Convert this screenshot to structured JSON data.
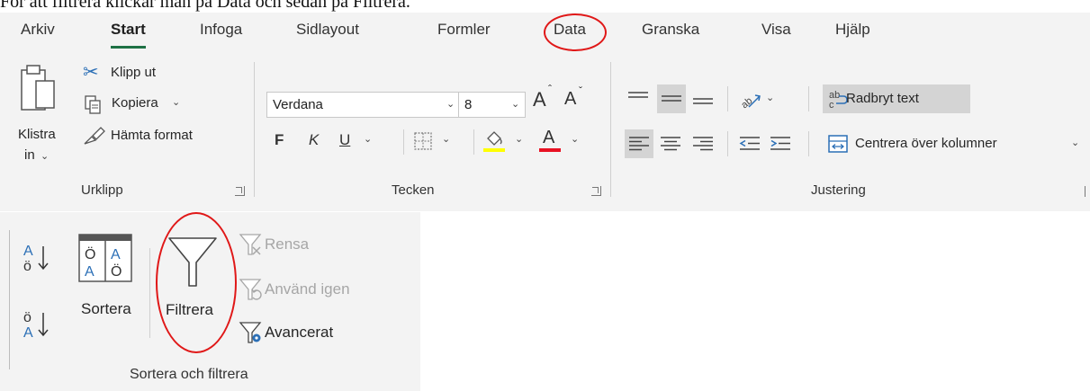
{
  "caption": "För att filtrera klickar man på Data och sedan på Filtrera.",
  "tabs": [
    "Arkiv",
    "Start",
    "Infoga",
    "Sidlayout",
    "Formler",
    "Data",
    "Granska",
    "Visa",
    "Hjälp"
  ],
  "clipboard": {
    "paste": "Klistra",
    "paste2": "in",
    "cut": "Klipp ut",
    "copy": "Kopiera",
    "format_painter": "Hämta format",
    "group": "Urklipp"
  },
  "font": {
    "name": "Verdana",
    "size": "8",
    "grow": "A",
    "shrink": "A",
    "bold": "F",
    "italic": "K",
    "underline": "U",
    "font_color_glyph": "A",
    "group": "Tecken"
  },
  "alignment": {
    "wrap_text": "Radbryt text",
    "merge_center": "Centrera över kolumner",
    "group": "Justering"
  },
  "sort_filter": {
    "sort": "Sortera",
    "filter": "Filtrera",
    "clear": "Rensa",
    "reapply": "Använd igen",
    "advanced": "Avancerat",
    "group": "Sortera och filtrera"
  },
  "colors": {
    "ribbon_bg": "#f3f3f3",
    "active_underline": "#1e7145",
    "annotation_red": "#e01818",
    "highlight_yellow": "#ffff00",
    "font_red": "#e81123",
    "accent_blue": "#2b6fb6"
  },
  "icons": [
    "paste-icon",
    "scissors-icon",
    "copy-icon",
    "paintbrush-icon",
    "borders-icon",
    "fill-bucket-icon",
    "orientation-icon",
    "wrap-icon",
    "merge-icon",
    "sort-az-icon",
    "sort-za-icon",
    "sort-dialog-icon",
    "funnel-icon",
    "funnel-clear-icon",
    "funnel-reapply-icon",
    "funnel-advanced-icon"
  ]
}
